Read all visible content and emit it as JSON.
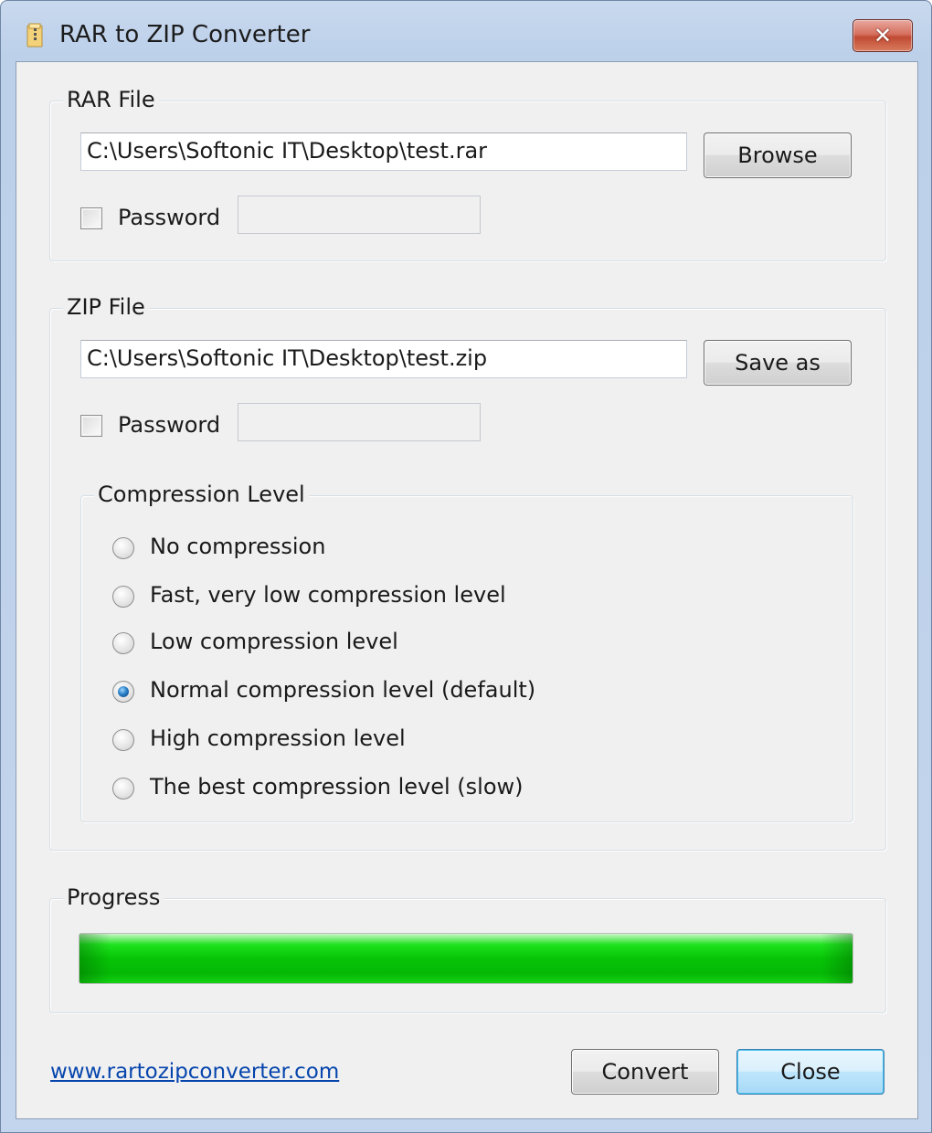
{
  "window": {
    "title": "RAR to ZIP Converter",
    "title_icon": "folder-zip-icon",
    "close_icon": "close-icon"
  },
  "rar_group": {
    "label": "RAR File",
    "path_value": "C:\\Users\\Softonic IT\\Desktop\\test.rar",
    "browse_label": "Browse",
    "password_label": "Password",
    "password_checked": false,
    "password_value": ""
  },
  "zip_group": {
    "label": "ZIP File",
    "path_value": "C:\\Users\\Softonic IT\\Desktop\\test.zip",
    "save_as_label": "Save as",
    "password_label": "Password",
    "password_checked": false,
    "password_value": ""
  },
  "compression": {
    "label": "Compression Level",
    "options": [
      {
        "label": "No compression",
        "selected": false
      },
      {
        "label": "Fast, very low compression level",
        "selected": false
      },
      {
        "label": "Low compression level",
        "selected": false
      },
      {
        "label": "Normal compression level (default)",
        "selected": true
      },
      {
        "label": "High compression level",
        "selected": false
      },
      {
        "label": "The best compression level (slow)",
        "selected": false
      }
    ]
  },
  "progress": {
    "label": "Progress",
    "value_fraction": 1.0,
    "color": "#06c406"
  },
  "footer": {
    "link_text": "www.rartozipconverter.com",
    "convert_label": "Convert",
    "close_label": "Close"
  }
}
